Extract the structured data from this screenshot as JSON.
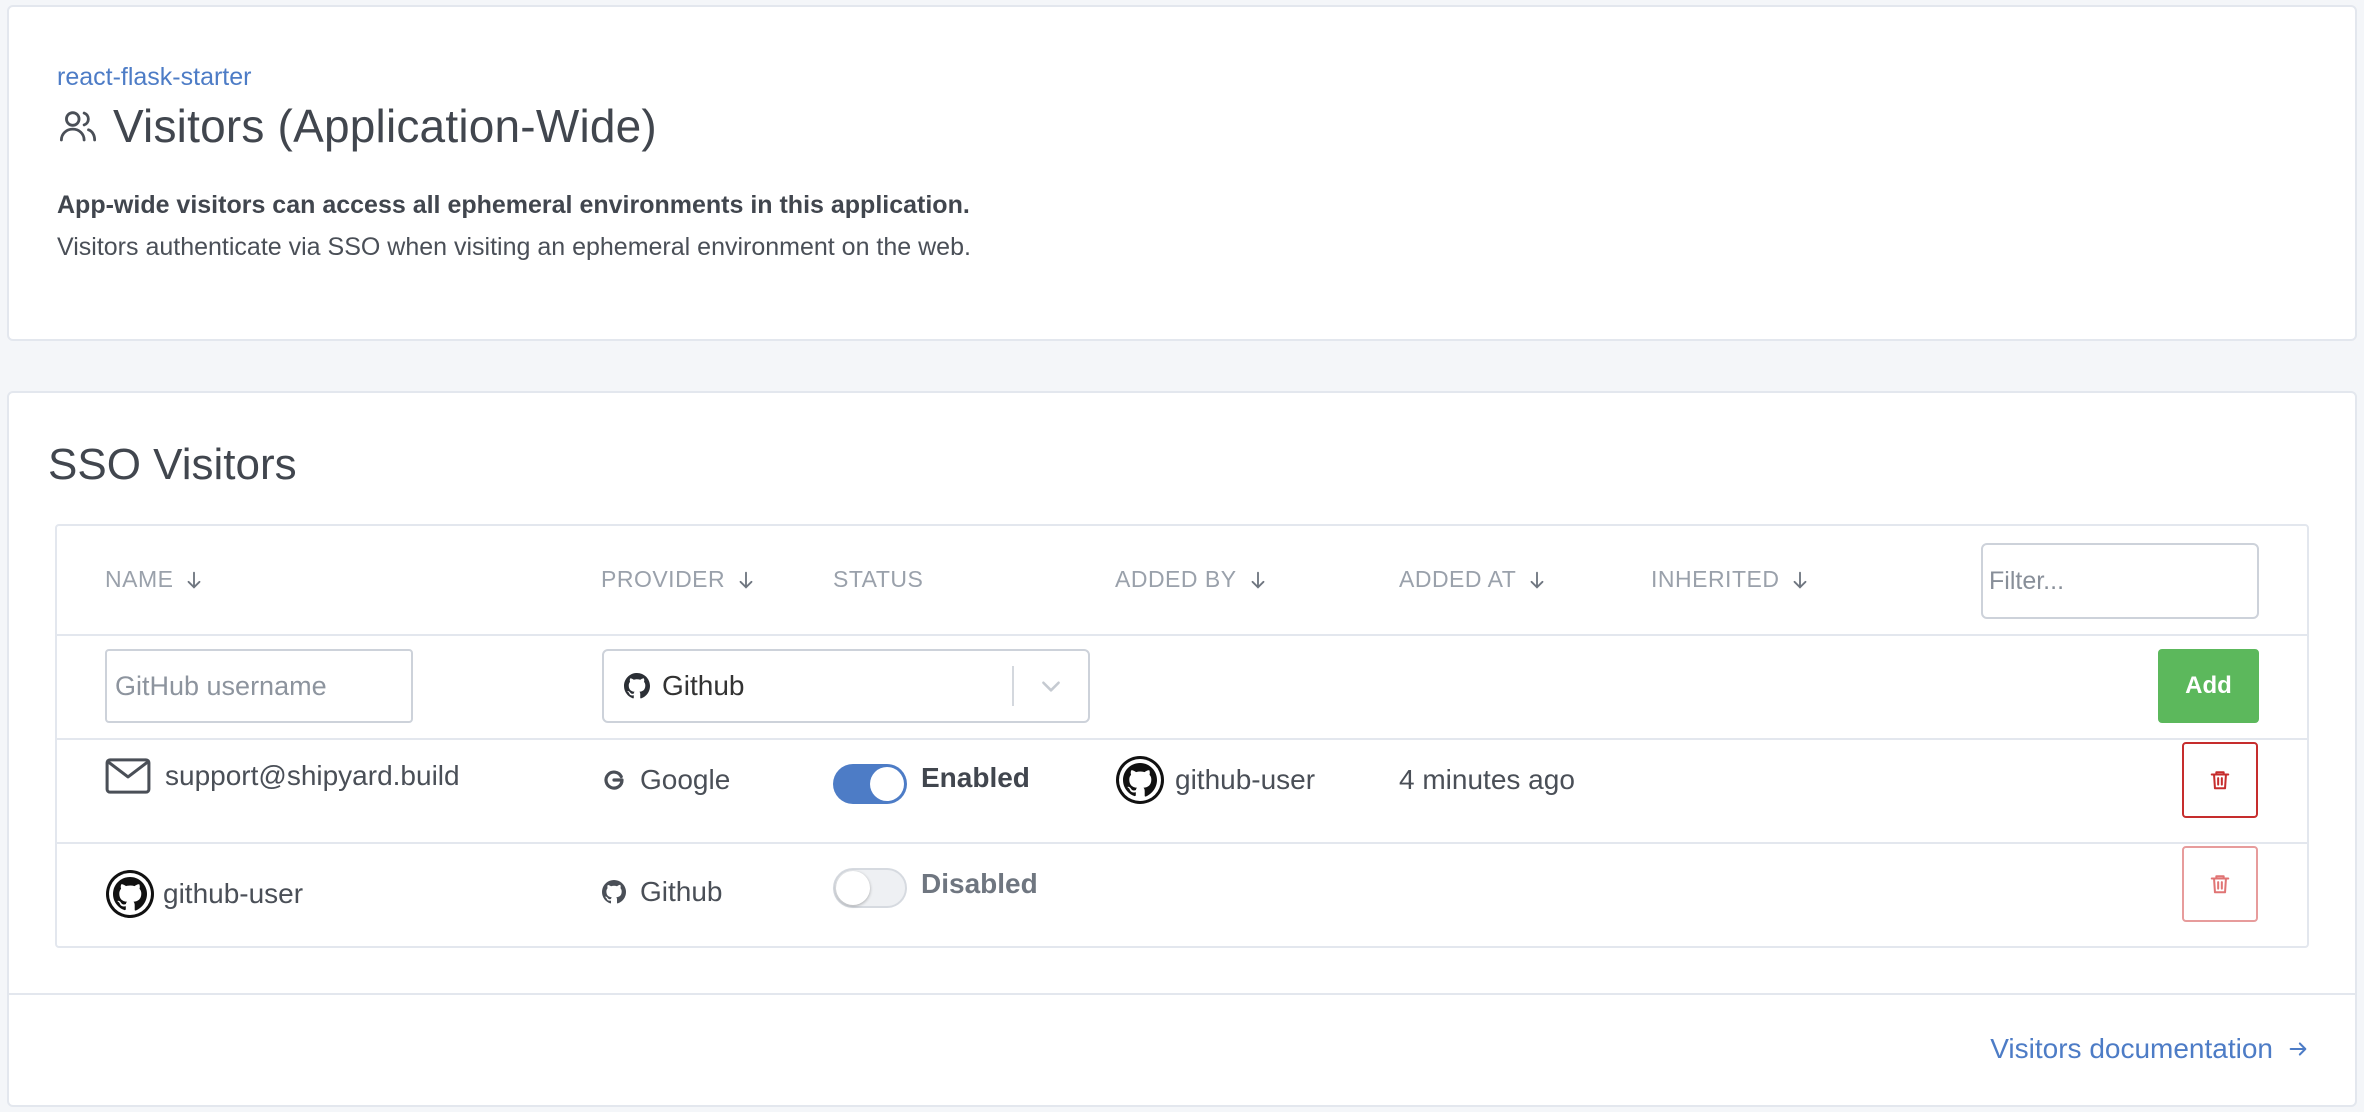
{
  "header": {
    "breadcrumb": "react-flask-starter",
    "title": "Visitors (Application-Wide)",
    "title_icon": "users-icon",
    "description_bold": "App-wide visitors can access all ephemeral environments in this application.",
    "description": "Visitors authenticate via SSO when visiting an ephemeral environment on the web."
  },
  "sso": {
    "title": "SSO Visitors",
    "columns": [
      {
        "label": "NAME",
        "sortable": true
      },
      {
        "label": "PROVIDER",
        "sortable": true
      },
      {
        "label": "STATUS",
        "sortable": false
      },
      {
        "label": "ADDED BY",
        "sortable": true
      },
      {
        "label": "ADDED AT",
        "sortable": true
      },
      {
        "label": "INHERITED",
        "sortable": true
      }
    ],
    "filter_placeholder": "Filter...",
    "new_visitor": {
      "username_placeholder": "GitHub username",
      "provider_selected": "Github",
      "add_label": "Add"
    },
    "rows": [
      {
        "name": "support@shipyard.build",
        "name_icon": "mail-icon",
        "provider": "Google",
        "provider_icon": "google-icon",
        "status": "Enabled",
        "enabled": true,
        "added_by": "github-user",
        "added_at": "4 minutes ago"
      },
      {
        "name": "github-user",
        "name_icon": "github-avatar-icon",
        "provider": "Github",
        "provider_icon": "github-icon",
        "status": "Disabled",
        "enabled": false,
        "added_by": "",
        "added_at": ""
      }
    ]
  },
  "footer": {
    "docs_link": "Visitors documentation"
  },
  "colors": {
    "accent": "#4d7cc6",
    "add_button": "#5cb85c",
    "danger": "#c62d2d",
    "text_dark": "#41464e",
    "header_muted": "#9aa1ab"
  }
}
